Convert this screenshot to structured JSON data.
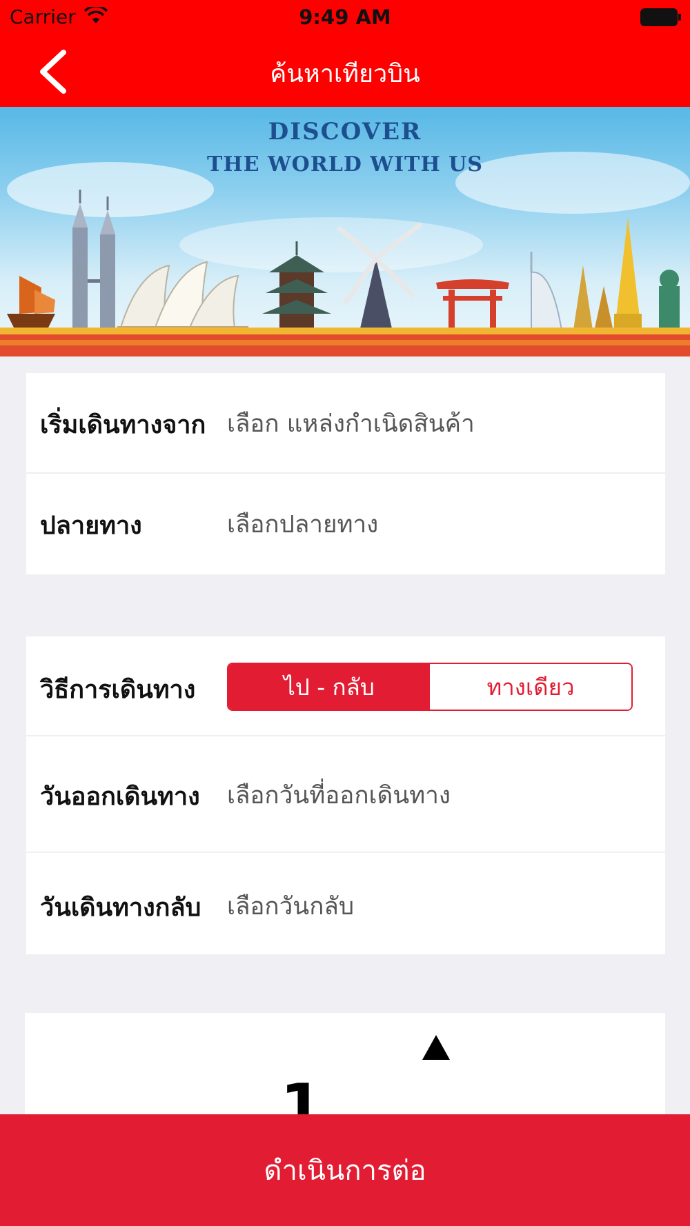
{
  "status_bar": {
    "carrier": "Carrier",
    "time": "9:49 AM",
    "wifi_icon": "wifi-icon",
    "battery_icon": "battery-icon"
  },
  "nav": {
    "title": "ค้นหาเทียวบิน",
    "back_icon": "chevron-left-icon",
    "background": "#ff0000"
  },
  "banner": {
    "line1": "DISCOVER",
    "line2": "THE WORLD WITH US"
  },
  "route": {
    "origin": {
      "label": "เริ่มเดินทางจาก",
      "value": "เลือก แหล่งกำเนิดสินค้า"
    },
    "destination": {
      "label": "ปลายทาง",
      "value": "เลือกปลายทาง"
    }
  },
  "trip": {
    "type": {
      "label": "วิธีการเดินทาง",
      "options": [
        "ไป - กลับ",
        "ทางเดียว"
      ],
      "selected": "ไป - กลับ"
    },
    "departure": {
      "label": "วันออกเดินทาง",
      "value": "เลือกวันที่ออกเดินทาง"
    },
    "return": {
      "label": "วันเดินทางกลับ",
      "value": "เลือกวันกลับ"
    }
  },
  "passengers": {
    "count": "1",
    "up_icon": "triangle-up-icon"
  },
  "continue_button": "ดำเนินการต่อ",
  "colors": {
    "accent": "#e21d33",
    "header": "#ff0000",
    "background": "#efeff4"
  }
}
